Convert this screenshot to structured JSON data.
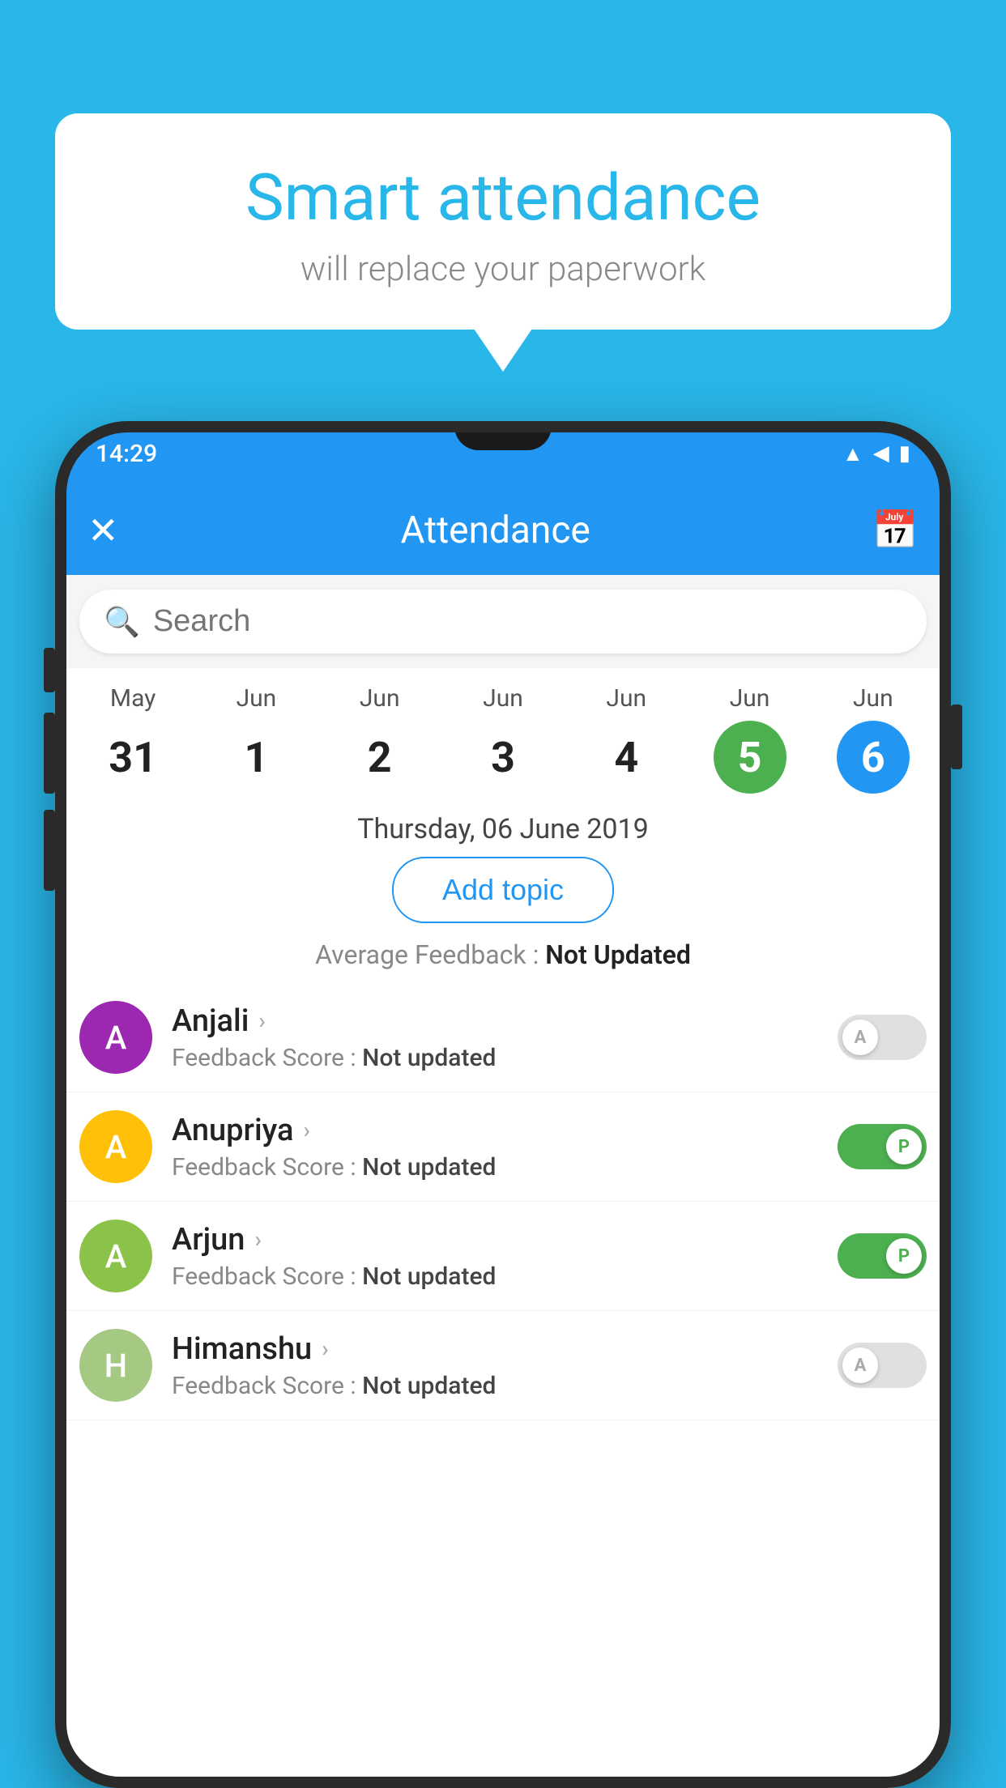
{
  "background_color": "#29b6e8",
  "speech_bubble": {
    "title": "Smart attendance",
    "subtitle": "will replace your paperwork"
  },
  "status_bar": {
    "time": "14:29",
    "icons": [
      "▲",
      "◀",
      "▮"
    ]
  },
  "app_bar": {
    "close_label": "✕",
    "title": "Attendance",
    "calendar_icon": "📅"
  },
  "search": {
    "placeholder": "Search"
  },
  "dates": [
    {
      "month": "May",
      "day": "31",
      "state": "normal"
    },
    {
      "month": "Jun",
      "day": "1",
      "state": "normal"
    },
    {
      "month": "Jun",
      "day": "2",
      "state": "normal"
    },
    {
      "month": "Jun",
      "day": "3",
      "state": "normal"
    },
    {
      "month": "Jun",
      "day": "4",
      "state": "normal"
    },
    {
      "month": "Jun",
      "day": "5",
      "state": "today"
    },
    {
      "month": "Jun",
      "day": "6",
      "state": "selected"
    }
  ],
  "selected_date_label": "Thursday, 06 June 2019",
  "add_topic_label": "Add topic",
  "avg_feedback_label": "Average Feedback :",
  "avg_feedback_value": "Not Updated",
  "students": [
    {
      "name": "Anjali",
      "avatar_letter": "A",
      "avatar_color": "#9c27b0",
      "feedback_label": "Feedback Score :",
      "feedback_value": "Not updated",
      "toggle_state": "off",
      "toggle_letter": "A"
    },
    {
      "name": "Anupriya",
      "avatar_letter": "A",
      "avatar_color": "#ffc107",
      "feedback_label": "Feedback Score :",
      "feedback_value": "Not updated",
      "toggle_state": "on",
      "toggle_letter": "P"
    },
    {
      "name": "Arjun",
      "avatar_letter": "A",
      "avatar_color": "#8bc34a",
      "feedback_label": "Feedback Score :",
      "feedback_value": "Not updated",
      "toggle_state": "on",
      "toggle_letter": "P"
    },
    {
      "name": "Himanshu",
      "avatar_letter": "H",
      "avatar_color": "#a5c882",
      "feedback_label": "Feedback Score :",
      "feedback_value": "Not updated",
      "toggle_state": "off",
      "toggle_letter": "A"
    }
  ]
}
